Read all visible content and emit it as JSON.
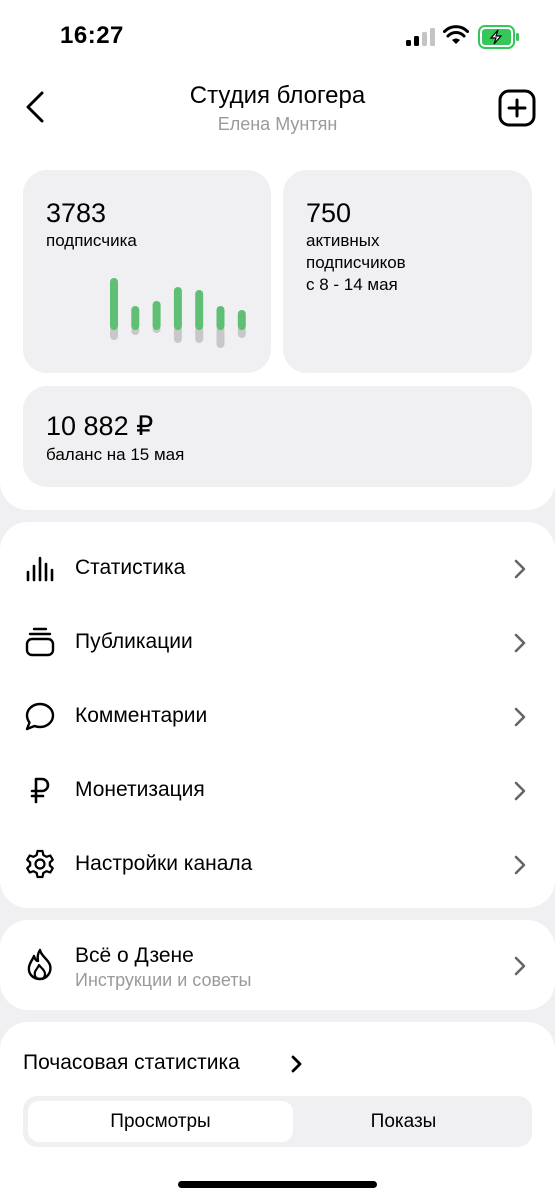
{
  "status_bar": {
    "time": "16:27"
  },
  "header": {
    "title": "Студия блогера",
    "subtitle": "Елена Мунтян"
  },
  "stats": {
    "subscribers": {
      "value": "3783",
      "label": "подписчика"
    },
    "active": {
      "value": "750",
      "label_lines": [
        "активных",
        "подписчиков",
        "с 8 - 14 мая"
      ]
    },
    "balance": {
      "value": "10 882 ₽",
      "label": "баланс на 15 мая"
    },
    "mini_chart": {
      "colors": {
        "up": "#5fbf74",
        "down": "#c8c8c8"
      },
      "bars": [
        {
          "up": 52,
          "down": 10
        },
        {
          "up": 24,
          "down": 5
        },
        {
          "up": 29,
          "down": 3
        },
        {
          "up": 43,
          "down": 13
        },
        {
          "up": 40,
          "down": 13
        },
        {
          "up": 24,
          "down": 18
        },
        {
          "up": 20,
          "down": 8
        }
      ]
    }
  },
  "menu": [
    {
      "label": "Статистика",
      "icon": "bar-chart-icon"
    },
    {
      "label": "Публикации",
      "icon": "stack-icon"
    },
    {
      "label": "Комментарии",
      "icon": "comment-icon"
    },
    {
      "label": "Монетизация",
      "icon": "ruble-icon"
    },
    {
      "label": "Настройки канала",
      "icon": "gear-icon"
    }
  ],
  "zen": {
    "title": "Всё о Дзене",
    "subtitle": "Инструкции и советы",
    "icon": "flame-icon"
  },
  "hourly": {
    "title": "Почасовая статистика",
    "tabs": [
      "Просмотры",
      "Показы"
    ],
    "selected": "Просмотры"
  },
  "colors": {
    "accent_green": "#5fbf74",
    "battery_green": "#35c759",
    "card_bg": "#f0f0f2"
  }
}
